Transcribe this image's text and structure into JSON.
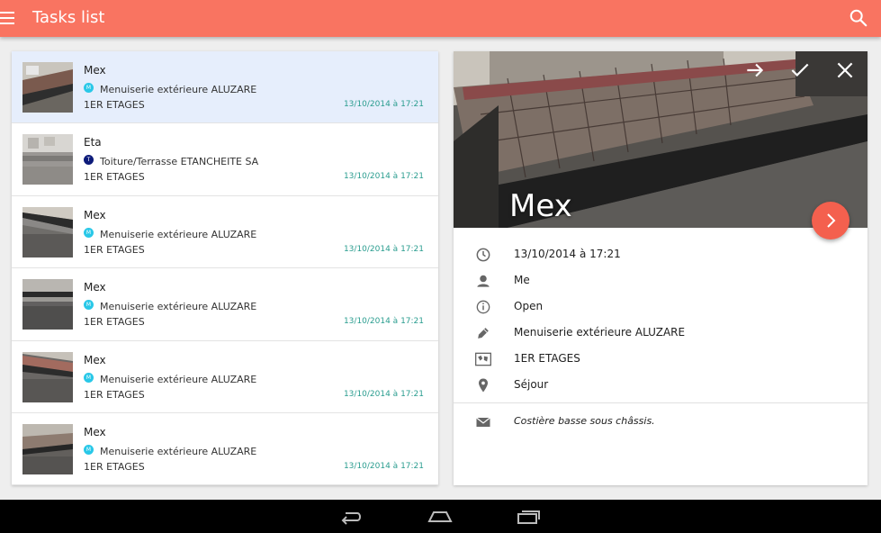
{
  "appbar": {
    "title": "Tasks list",
    "menu_icon": "hamburger-icon",
    "search_icon": "search-icon"
  },
  "colors": {
    "accent": "#f97461",
    "fab": "#f4604e",
    "selected_row": "#e6eefc",
    "date_text": "#2a9d8f",
    "dot_cyan": "#29c8e8",
    "dot_navy": "#0d1b7a"
  },
  "tasks": [
    {
      "title": "Mex",
      "badge": "M",
      "company": "Menuiserie extérieure ALUZARE",
      "floor": "1ER ETAGES",
      "date": "13/10/2014 à 17:21"
    },
    {
      "title": "Eta",
      "badge": "T",
      "company": "Toiture/Terrasse ETANCHEITE SA",
      "floor": "1ER ETAGES",
      "date": "13/10/2014 à 17:21"
    },
    {
      "title": "Mex",
      "badge": "M",
      "company": "Menuiserie extérieure ALUZARE",
      "floor": "1ER ETAGES",
      "date": "13/10/2014 à 17:21"
    },
    {
      "title": "Mex",
      "badge": "M",
      "company": "Menuiserie extérieure ALUZARE",
      "floor": "1ER ETAGES",
      "date": "13/10/2014 à 17:21"
    },
    {
      "title": "Mex",
      "badge": "M",
      "company": "Menuiserie extérieure ALUZARE",
      "floor": "1ER ETAGES",
      "date": "13/10/2014 à 17:21"
    },
    {
      "title": "Mex",
      "badge": "M",
      "company": "Menuiserie extérieure ALUZARE",
      "floor": "1ER ETAGES",
      "date": "13/10/2014 à 17:21"
    }
  ],
  "detail": {
    "title": "Mex",
    "actions": [
      "forward-arrow-icon",
      "check-icon",
      "close-icon"
    ],
    "fab_icon": "chevron-right-icon",
    "date": "13/10/2014 à 17:21",
    "assignee": "Me",
    "status": "Open",
    "company": "Menuiserie extérieure ALUZARE",
    "floor": "1ER ETAGES",
    "room": "Séjour",
    "note": "Costière basse sous châssis."
  },
  "navbar": {
    "buttons": [
      "back-icon",
      "home-icon",
      "recents-icon"
    ]
  }
}
